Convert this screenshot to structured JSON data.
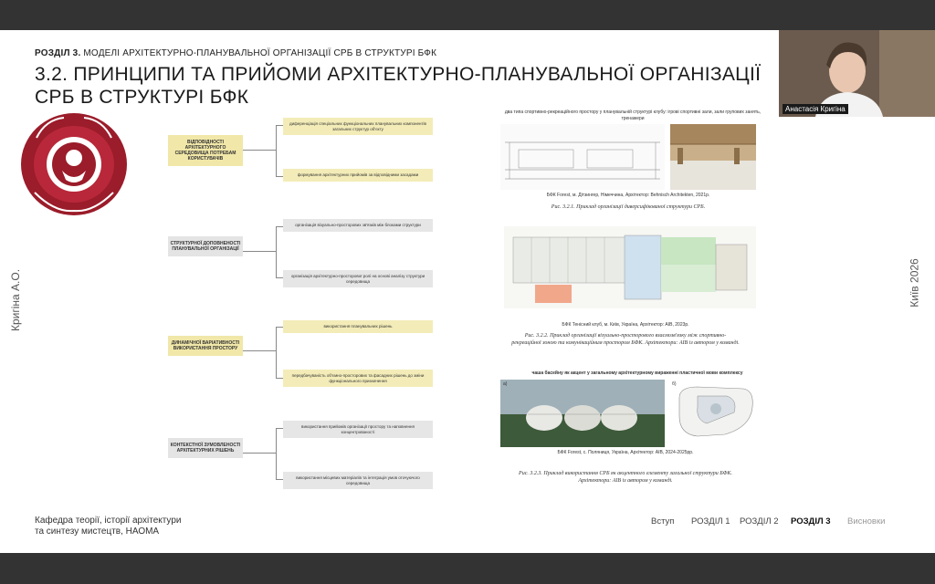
{
  "slide": {
    "section_label_bold": "РОЗДІЛ 3.",
    "section_label_rest": " МОДЕЛІ АРХІТЕКТУРНО-ПЛАНУВАЛЬНОЇ ОРГАНІЗАЦІЇ СРБ В СТРУКТУРІ БФК",
    "title": "3.2. ПРИНЦИПИ ТА ПРИЙОМИ АРХІТЕКТУРНО-ПЛАНУВАЛЬНОЇ ОРГАНІЗАЦІЇ СРБ В СТРУКТУРІ БФК",
    "side_left": "Кригіна А.О.",
    "side_right": "Київ 2026",
    "diagram": {
      "main_nodes": [
        "ВІДПОВІДНОСТІ АРХІТЕКТУРНОГО СЕРЕДОВИЩА ПОТРЕБАМ КОРИСТУВАЧІВ",
        "СТРУКТУРНОЇ ДОПОВНЕНОСТІ ПЛАНУВАЛЬНОЇ ОРГАНІЗАЦІЇ",
        "ДИНАМІЧНОЇ ВАРІАТИВНОСТІ ВИКОРИСТАННЯ ПРОСТОРУ",
        "КОНТЕКСТНОЇ ЗУМОВЛЕНОСТІ АРХІТЕКТУРНИХ РІШЕНЬ"
      ],
      "sub_nodes": [
        "диференціація спеціальних функціональних планувальних компонентів загальних структур об'єкту",
        "формування архітектурних прийомів за відповідними засадами",
        "організація візуально-просторових зв'язків між блоками структури",
        "організація архітектурно-просторової ролі на основі аналізу структури середовища",
        "використання планувальних рішень",
        "передбачуваність об'ємно-просторових та фасадних рішень до зміни функціонального призначення",
        "використання прийомів організації простору та наповнення концентрованості",
        "використання місцевих матеріалів та інтеграція умов оточуючого середовища"
      ]
    },
    "figures": {
      "top_caption": "два типа спортивно-рекреаційного простору у планувальній структурі клубу: ігрові спортивні зали, зали групових занять, тренажери",
      "fig1_credit": "БФК Forest, м. Дітзингер, Німеччина, Архітектор: Behnisch Architekten, 2021р.",
      "fig1_caption": "Рис. 3.2.1. Приклад організації диверсифікованої структури СРБ.",
      "fig2_credit": "БФК Тенісний клуб, м. Київ, Україна, Архітектор: АІВ, 2023р.",
      "fig2_caption": "Рис. 3.2.2. Приклад організації візуально-просторового взаємозв'язку між спортивно-рекреаційної зоною та комунікаційним простором БФК. Архітектори: АІВ із автором у команді.",
      "fig3_header": "чаша басейну як акцент у загальному архітектурному вираженні пластичної мови комплексу",
      "fig3_credit": "БФК Forest, с. Поляниця, Україна, Архітектор: АІВ, 2024-2025рр.",
      "fig3_caption": "Рис. 3.2.3. Приклад використання СРБ як акцентного елементу загальної структури БФК. Архітектори: АІВ із автором у команді.",
      "fig3_label_a": "а)",
      "fig3_label_b": "б)"
    },
    "footer": {
      "line1": "Кафедра теорії, історії архітектури",
      "line2": "та синтезу мистецтв, НАОМА"
    },
    "nav": [
      "Вступ",
      "РОЗДІЛ 1",
      "РОЗДІЛ 2",
      "РОЗДІЛ 3",
      "Висновки"
    ],
    "nav_active": "РОЗДІЛ 3"
  },
  "video": {
    "participant_name": "Анастасія Кригіна"
  },
  "colors": {
    "emblem": "#9b1c2a",
    "node_yellow": "#f1e7a8",
    "node_gray": "#e4e4e4"
  }
}
